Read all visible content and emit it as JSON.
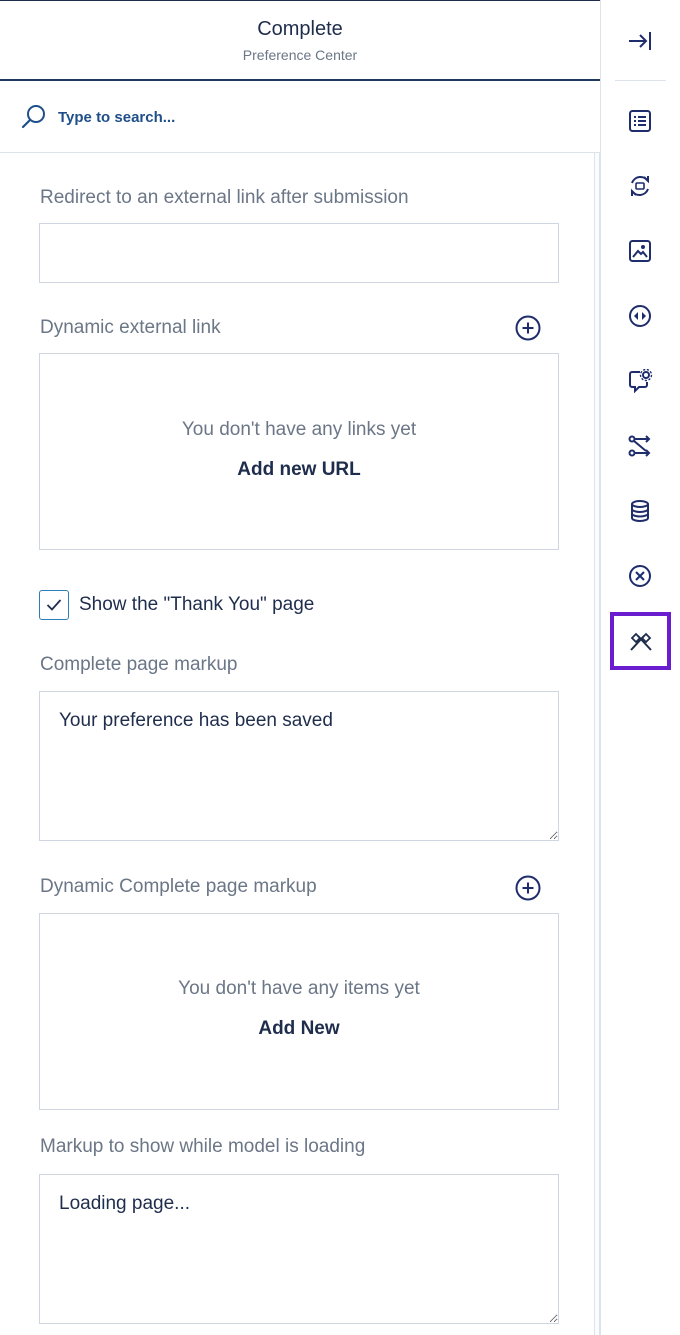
{
  "header": {
    "title": "Complete",
    "subtitle": "Preference Center"
  },
  "search": {
    "placeholder": "Type to search..."
  },
  "form": {
    "redirect": {
      "label": "Redirect to an external link after submission",
      "value": ""
    },
    "dynamic_link": {
      "label": "Dynamic external link",
      "empty_text": "You don't have any links yet",
      "add_label": "Add new URL"
    },
    "thank_you": {
      "label": "Show the \"Thank You\" page",
      "checked": true
    },
    "complete_markup": {
      "label": "Complete page markup",
      "value": "Your preference has been saved"
    },
    "dynamic_markup": {
      "label": "Dynamic Complete page markup",
      "empty_text": "You don't have any items yet",
      "add_label": "Add New"
    },
    "loading_markup": {
      "label": "Markup to show while model is loading",
      "value": "Loading page..."
    }
  },
  "toolbar": {
    "items": [
      {
        "icon": "collapse-panel-icon"
      },
      {
        "icon": "list-form-icon"
      },
      {
        "icon": "refresh-cycle-icon"
      },
      {
        "icon": "image-icon"
      },
      {
        "icon": "code-navigation-icon"
      },
      {
        "icon": "chat-settings-icon"
      },
      {
        "icon": "route-icon"
      },
      {
        "icon": "database-icon"
      },
      {
        "icon": "circle-close-icon"
      },
      {
        "icon": "finish-flags-icon",
        "active": true
      }
    ],
    "active_color": "#6a1ccf"
  },
  "colors": {
    "text_primary": "#1f2d4d",
    "text_muted": "#6b7686",
    "accent": "#1f4f8a",
    "border": "#cfd6df"
  }
}
